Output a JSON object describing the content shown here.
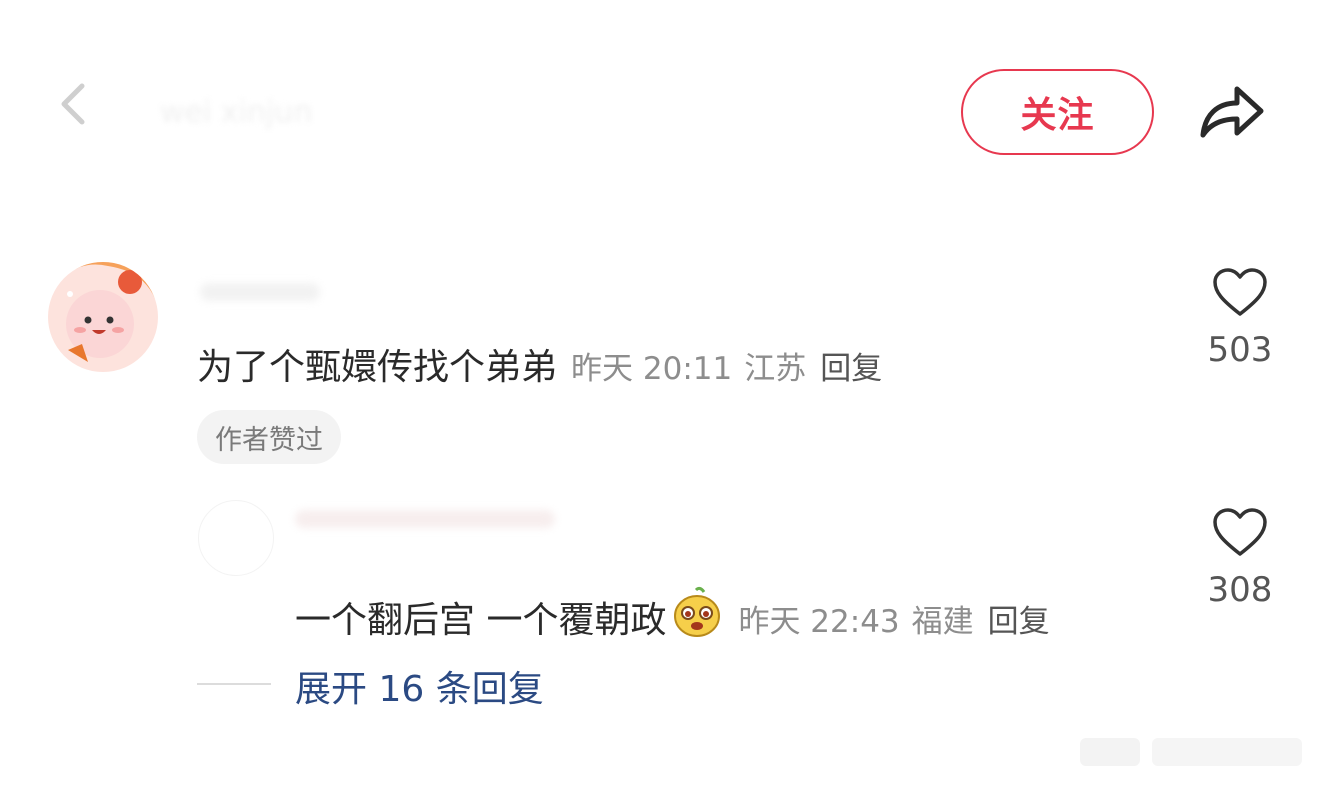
{
  "header": {
    "username": "wei xinjun",
    "follow_label": "关注"
  },
  "comments": [
    {
      "text": "为了个甄嬛传找个弟弟",
      "time": "昨天 20:11",
      "location": "江苏",
      "reply_label": "回复",
      "likes": "503",
      "badge": "作者赞过"
    },
    {
      "text": "一个翻后宫 一个覆朝政",
      "time": "昨天 22:43",
      "location": "福建",
      "reply_label": "回复",
      "likes": "308"
    }
  ],
  "expand_replies": "展开 16 条回复",
  "icons": {
    "back": "chevron-left-icon",
    "share": "share-arrow-icon",
    "like": "heart-outline-icon"
  },
  "colors": {
    "accent": "#e7384f",
    "link": "#2b4a83",
    "meta": "#8d8d8d"
  }
}
